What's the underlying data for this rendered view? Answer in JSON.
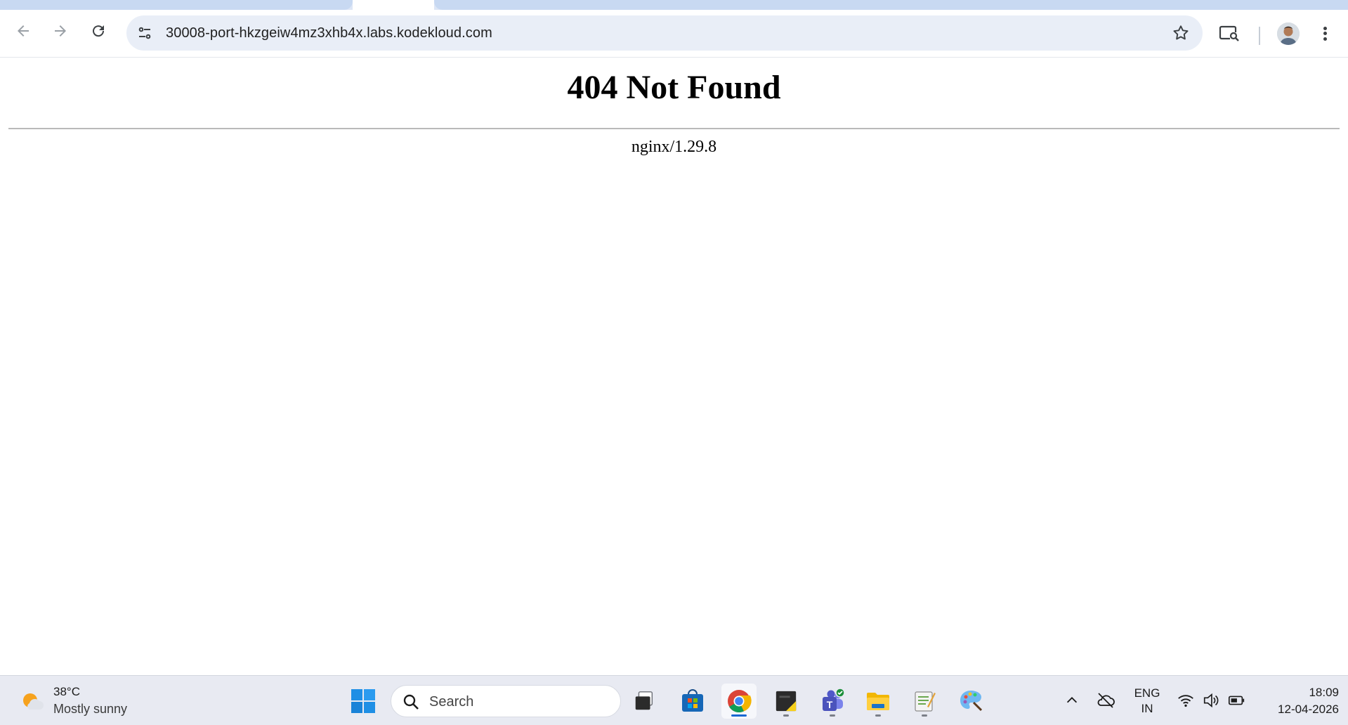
{
  "browser": {
    "url": "30008-port-hkzgeiw4mz3xhb4x.labs.kodekloud.com",
    "icons": [
      "back-arrow-icon",
      "forward-arrow-icon",
      "reload-icon",
      "site-info-icon",
      "bookmark-star-icon",
      "cast-search-icon",
      "profile-avatar",
      "kebab-menu-icon"
    ]
  },
  "page": {
    "heading": "404 Not Found",
    "server": "nginx/1.29.8"
  },
  "taskbar": {
    "weather": {
      "temperature": "38°C",
      "condition": "Mostly sunny"
    },
    "search_label": "Search",
    "apps": [
      "start-button",
      "task-view",
      "microsoft-store",
      "chrome",
      "sticky-notes",
      "teams",
      "file-explorer",
      "notepad-app",
      "paint"
    ],
    "active_app": "chrome",
    "tray": {
      "language_top": "ENG",
      "language_bottom": "IN",
      "time": "18:09",
      "date": "12-04-2026"
    }
  },
  "colors": {
    "accent": "#1967d2",
    "omnibox_bg": "#e9eef7",
    "taskbar_bg": "#e8eaf2"
  }
}
